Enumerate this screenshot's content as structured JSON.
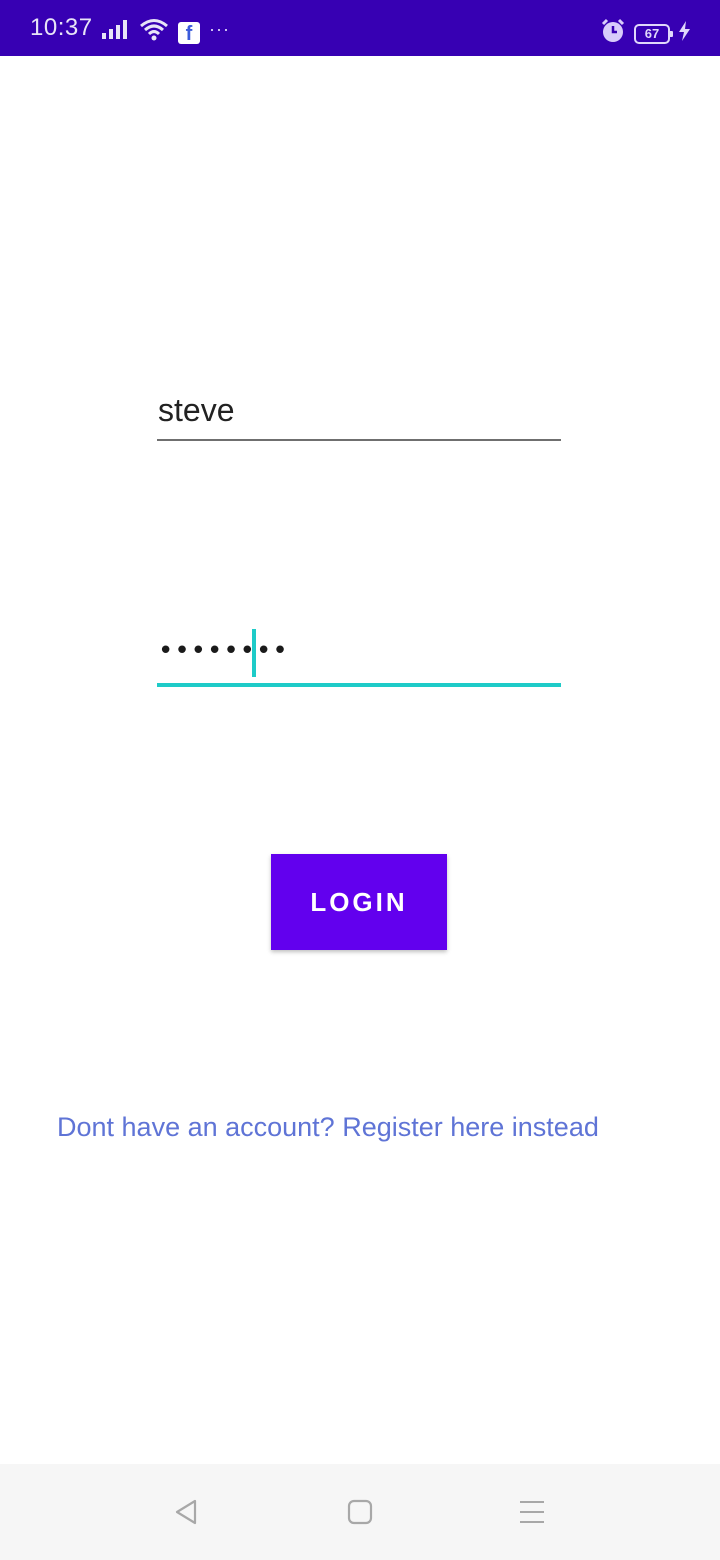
{
  "status_bar": {
    "time": "10:37",
    "battery_level": "67",
    "icons": [
      "signal-icon",
      "wifi-icon",
      "facebook-icon",
      "more-dots-icon",
      "alarm-icon",
      "battery-icon",
      "charging-icon"
    ],
    "background_color": "#3700b3"
  },
  "login_form": {
    "username_value": "steve",
    "password_value": "••••••••",
    "login_button_label": "LOGIN",
    "register_link_text": "Dont have an account? Register here instead",
    "accent_color": "#1ecbc8",
    "button_color": "#6200ee",
    "link_color": "#5f74d6"
  },
  "nav_bar": {
    "icons": [
      "back-icon",
      "home-icon",
      "recents-icon"
    ]
  }
}
